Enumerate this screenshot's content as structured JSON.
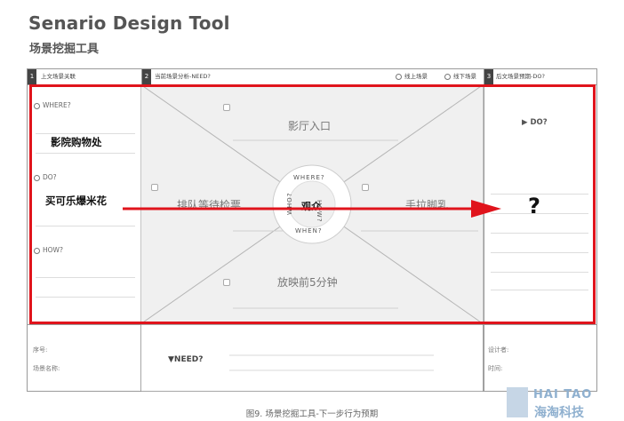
{
  "title": "Senario Design Tool",
  "subtitle": "场景挖掘工具",
  "columns": {
    "left": {
      "number": "1",
      "label": "上文场景关联"
    },
    "center": {
      "number": "2",
      "label": "当前场景分析-NEED?",
      "option_online": "线上场景",
      "option_offline": "线下场景"
    },
    "right": {
      "number": "3",
      "label": "后文场景预期-DO?"
    }
  },
  "left_panel": {
    "where_label": "WHERE?",
    "where_answer": "影院购物处",
    "do_label": "DO?",
    "do_answer": "买可乐爆米花",
    "how_label": "HOW?"
  },
  "center_panel": {
    "top_zone": "影厅入口",
    "left_zone": "排队等待检票",
    "right_zone": "手拉脚乳",
    "bottom_zone": "放映前5分钟",
    "hub_center": "观众",
    "ring_where": "WHERE?",
    "ring_how": "HOW?",
    "ring_when": "WHEN?",
    "ring_who": "WHO?"
  },
  "right_panel": {
    "do_label": "▶ DO?",
    "question": "?"
  },
  "footer": {
    "serial_label": "序号:",
    "scene_name_label": "场景名称:",
    "need_label": "▼NEED?",
    "designer_label": "设计者:",
    "time_label": "时间:"
  },
  "caption": "图9. 场景挖掘工具-下一步行为预期",
  "watermark": {
    "line1": "HAI TAO",
    "line2": "海淘科技"
  },
  "colors": {
    "highlight": "#e0141c",
    "frame": "#9a9a9a",
    "zone_fill": "#f0f0f0"
  }
}
